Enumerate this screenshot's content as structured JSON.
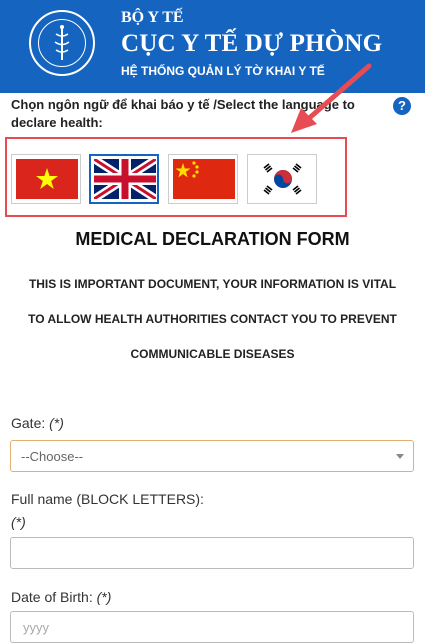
{
  "header": {
    "ministry": "BỘ Y TẾ",
    "department": "CỤC Y TẾ DỰ PHÒNG",
    "system": "HỆ THỐNG QUẢN LÝ TỜ KHAI Y TẾ",
    "bg_color": "#1565c0"
  },
  "language": {
    "label": "Chọn ngôn ngữ để khai báo y tế /Select the language to declare health:",
    "help_icon": "?",
    "flags": [
      "vietnam-flag-icon",
      "uk-flag-icon",
      "china-flag-icon",
      "korea-flag-icon"
    ],
    "selected": "uk-flag-icon",
    "highlight_color": "#e74c55"
  },
  "form": {
    "title": "MEDICAL DECLARATION FORM",
    "notice_lines": [
      "THIS IS IMPORTANT DOCUMENT, YOUR INFORMATION IS VITAL",
      "TO ALLOW HEALTH AUTHORITIES CONTACT YOU TO PREVENT",
      "COMMUNICABLE DISEASES"
    ],
    "gate": {
      "label": "Gate:",
      "required": "(*)",
      "value": "--Choose--"
    },
    "full_name": {
      "label": "Full name (BLOCK LETTERS):",
      "required": "(*)",
      "value": ""
    },
    "dob": {
      "label": "Date of Birth:",
      "required": "(*)",
      "placeholder": "yyyy"
    }
  }
}
